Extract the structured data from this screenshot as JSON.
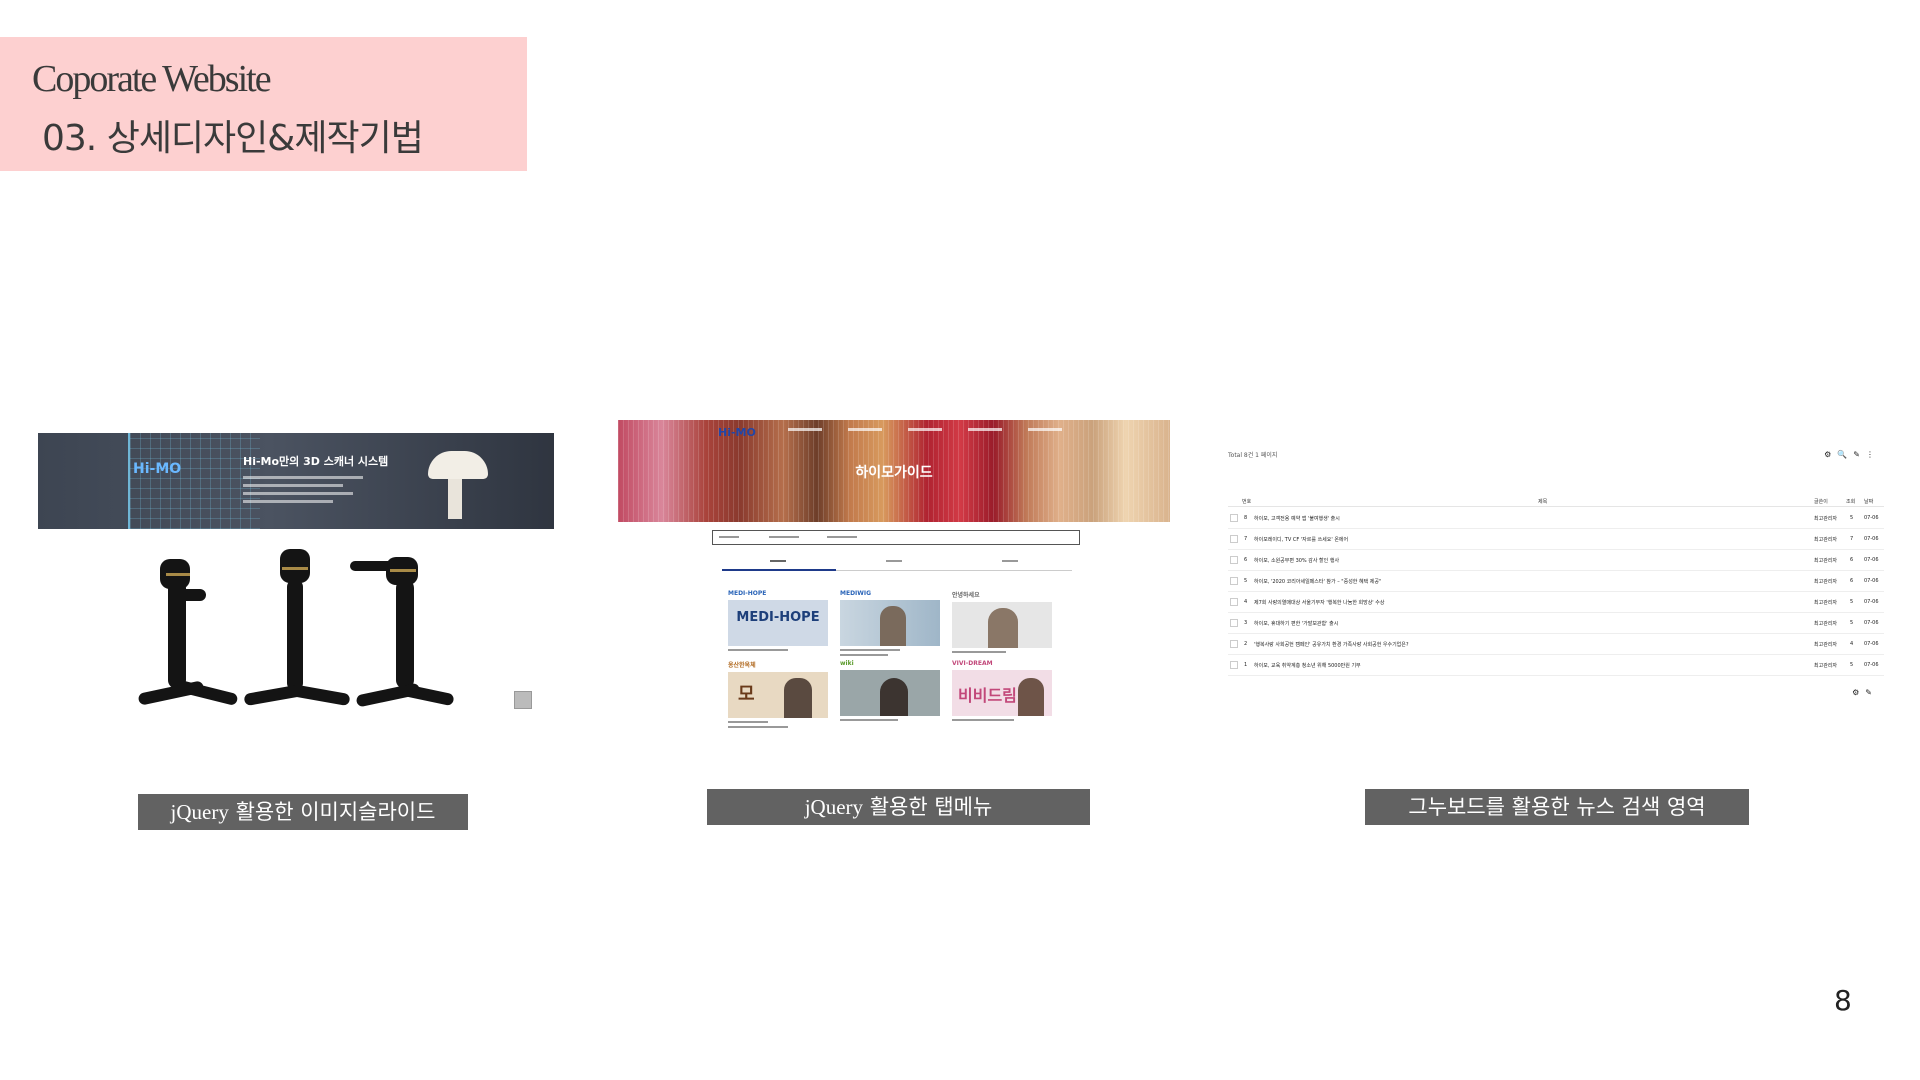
{
  "header": {
    "title_en": "Coporate Website",
    "subtitle_ko": "03. 상세디자인&제작기법"
  },
  "panels": {
    "slide": {
      "brand": "Hi-MO",
      "banner_title": "Hi-Mo만의 3D 스캐너 시스템"
    },
    "tabmenu": {
      "brand": "Hi-MO",
      "hero_title": "하이모가이드",
      "cards": [
        {
          "label": "MEDI-HOPE",
          "image_text": "MEDI-HOPE"
        },
        {
          "label": "MEDIWIG",
          "image_text": ""
        },
        {
          "label": "안녕하세요",
          "image_text": ""
        },
        {
          "label": "옹산한옥체",
          "image_text": "모"
        },
        {
          "label": "wiki",
          "image_text": ""
        },
        {
          "label": "VIVI-DREAM",
          "image_text": "비비드림"
        }
      ]
    },
    "board": {
      "total": "Total 8건 1 페이지",
      "headers": {
        "num": "번호",
        "title": "제목",
        "author": "글쓴이",
        "views": "조회",
        "date": "날짜"
      },
      "rows": [
        {
          "num": "8",
          "title": "하이모, 고객전용 예약 앱 '불여행생' 출시",
          "author": "최고관리자",
          "views": "5",
          "date": "07-06"
        },
        {
          "num": "7",
          "title": "하이모레이디, TV CF '자르를 쓰세요' 온에어",
          "author": "최고관리자",
          "views": "7",
          "date": "07-06"
        },
        {
          "num": "6",
          "title": "하이모, 소원공부편 30% 감사 할인 행사",
          "author": "최고관리자",
          "views": "6",
          "date": "07-06"
        },
        {
          "num": "5",
          "title": "하이모, '2020 코리아세일페스타' 참가 – \"중성한 혜택 제공\"",
          "author": "최고관리자",
          "views": "6",
          "date": "07-06"
        },
        {
          "num": "4",
          "title": "제7회 사랑의열매대상 서울기부자 '행복한 나눔한 희망상' 수상",
          "author": "최고관리자",
          "views": "5",
          "date": "07-06"
        },
        {
          "num": "3",
          "title": "하이모, 휴대하기 편한 '가발보관함' 출시",
          "author": "최고관리자",
          "views": "5",
          "date": "07-06"
        },
        {
          "num": "2",
          "title": "'행복사랑 사회공헌 캠페인' 공유가치 환경 가족사랑 사회공헌 우수기업은?",
          "author": "최고관리자",
          "views": "4",
          "date": "07-06"
        },
        {
          "num": "1",
          "title": "하이모, 교육 취약계층 청소년 위해 5000만원 기부",
          "author": "최고관리자",
          "views": "5",
          "date": "07-06"
        }
      ]
    }
  },
  "labels": {
    "l1_en": "jQuery",
    "l1_ko": "활용한  이미지슬라이드",
    "l2_en": "jQuery",
    "l2_ko": "활용한 탭메뉴",
    "l3": "그누보드를 활용한 뉴스 검색 영역"
  },
  "page_number": "8",
  "colors": {
    "header_bg": "#fdd0d0",
    "label_bg": "#626262"
  }
}
